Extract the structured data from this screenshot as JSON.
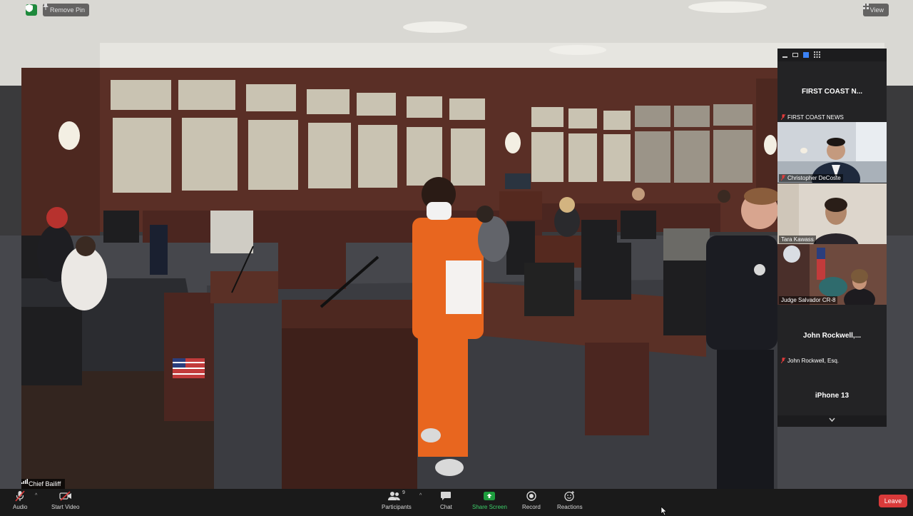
{
  "top_bar": {
    "remove_pin_label": "Remove Pin",
    "view_label": "View"
  },
  "main_video": {
    "speaker_label": "Chief Bailiff"
  },
  "gallery": {
    "tiles": [
      {
        "display_name": "FIRST COAST N...",
        "label": "FIRST COAST NEWS"
      },
      {
        "label": "Christopher DeCoste"
      },
      {
        "label": "Tara Kawass"
      },
      {
        "label": "Judge Salvador CR-8"
      },
      {
        "display_name": "John  Rockwell,...",
        "label": "John Rockwell, Esq."
      },
      {
        "display_name": "iPhone 13"
      }
    ]
  },
  "toolbar": {
    "audio": "Audio",
    "start_video": "Start Video",
    "participants": "Participants",
    "participants_count": "9",
    "chat": "Chat",
    "share_screen": "Share Screen",
    "record": "Record",
    "reactions": "Reactions",
    "leave": "Leave"
  },
  "colors": {
    "share_screen": "#1e9e3e",
    "leave": "#d93a3a",
    "mute": "#e03b3b",
    "security": "#1e8a3c"
  }
}
